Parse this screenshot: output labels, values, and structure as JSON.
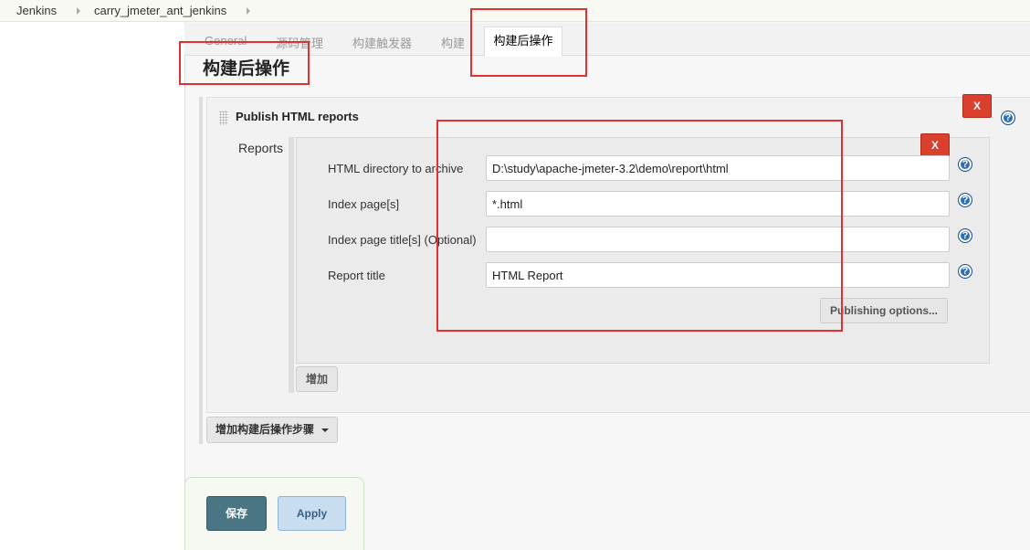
{
  "breadcrumb": {
    "items": [
      "Jenkins",
      "carry_jmeter_ant_jenkins"
    ]
  },
  "tabs": {
    "items": [
      "General",
      "源码管理",
      "构建触发器",
      "构建"
    ],
    "active": "构建后操作"
  },
  "section": {
    "title": "构建后操作"
  },
  "publisher": {
    "title": "Publish HTML reports",
    "delete_label": "X",
    "reports_label": "Reports",
    "report": {
      "delete_label": "X",
      "fields": [
        {
          "label": "HTML directory to archive",
          "value": "D:\\study\\apache-jmeter-3.2\\demo\\report\\html"
        },
        {
          "label": "Index page[s]",
          "value": "*.html"
        },
        {
          "label": "Index page title[s] (Optional)",
          "value": ""
        },
        {
          "label": "Report title",
          "value": "HTML Report"
        }
      ],
      "publishing_options_label": "Publishing options..."
    },
    "add_label": "增加"
  },
  "add_step_label": "增加构建后操作步骤",
  "actions": {
    "save_label": "保存",
    "apply_label": "Apply"
  },
  "help_glyph": "?",
  "colors": {
    "delete": "#d9412e",
    "save": "#4a7684",
    "apply": "#c9ddf0",
    "highlight": "#e03030"
  }
}
